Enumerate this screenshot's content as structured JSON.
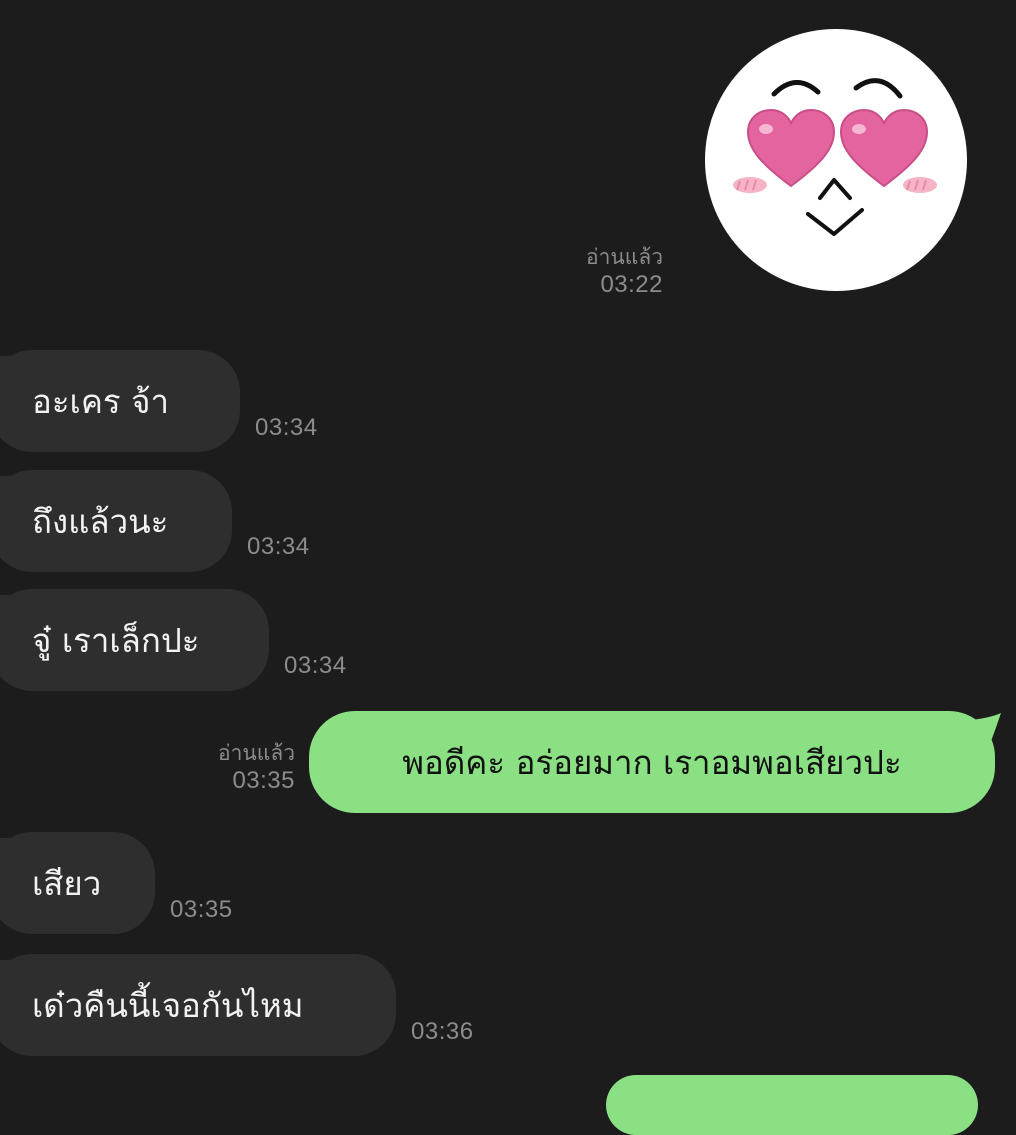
{
  "sticker": {
    "icon": "heart-eyes-face-sticker"
  },
  "messages": [
    {
      "dir": "out",
      "kind": "sticker",
      "read": "อ่านแล้ว",
      "time": "03:22"
    },
    {
      "dir": "in",
      "text": "อะเคร จ้า",
      "time": "03:34"
    },
    {
      "dir": "in",
      "text": "ถึงแล้วนะ",
      "time": "03:34"
    },
    {
      "dir": "in",
      "text": "จู๋ เราเล็กปะ",
      "time": "03:34"
    },
    {
      "dir": "out",
      "text": "พอดีคะ อร่อยมาก เราอมพอเสียวปะ",
      "read": "อ่านแล้ว",
      "time": "03:35"
    },
    {
      "dir": "in",
      "text": "เสียว",
      "time": "03:35"
    },
    {
      "dir": "in",
      "text": "เด๋วคืนนี้เจอกันไหม",
      "time": "03:36"
    }
  ],
  "colors": {
    "background": "#1c1c1c",
    "incoming_bubble": "#2e2e2e",
    "outgoing_bubble": "#8be084",
    "meta_text": "#8c8c8c"
  }
}
